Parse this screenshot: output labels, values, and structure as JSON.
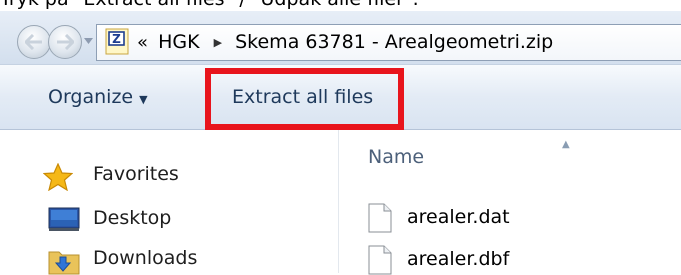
{
  "caption": "Tryk på \"Extract all files\" / \"Udpak alle filer\".",
  "window": {
    "breadcrumb": {
      "overflow": "«",
      "parts": [
        "HGK",
        "Skema 63781 - Arealgeometri.zip"
      ]
    },
    "toolbar": {
      "organize_label": "Organize",
      "extract_label": "Extract all files"
    },
    "nav": {
      "favorites": "Favorites",
      "desktop": "Desktop",
      "downloads": "Downloads"
    },
    "list": {
      "column_name": "Name",
      "files": [
        "arealer.dat",
        "arealer.dbf"
      ]
    }
  },
  "icons": {
    "back": "back-arrow-icon",
    "forward": "forward-arrow-icon",
    "zip": "zip-folder-icon",
    "favorites": "star-icon",
    "desktop": "desktop-icon",
    "downloads": "downloads-folder-icon",
    "file": "file-icon"
  },
  "colors": {
    "highlight": "#e8141c",
    "toolbar_text": "#1e395b"
  }
}
